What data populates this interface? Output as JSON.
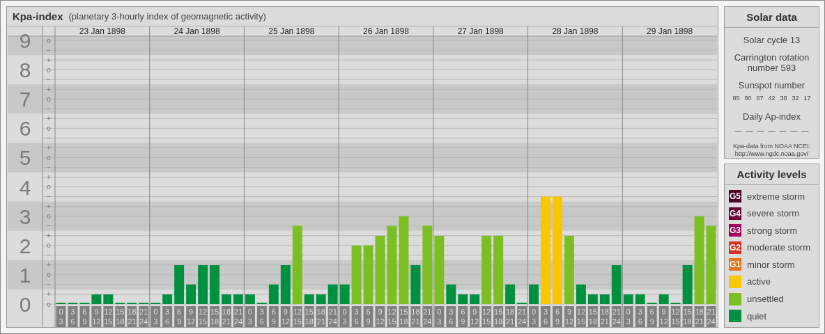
{
  "header": {
    "title": "Kpa-index",
    "subtitle": "(planetary 3-hourly index of geomagnetic activity)"
  },
  "day_headers": [
    "23 Jan 1898",
    "24 Jan 1898",
    "25 Jan 1898",
    "26 Jan 1898",
    "27 Jan 1898",
    "28 Jan 1898",
    "29 Jan 1898"
  ],
  "kp_scale_marks": [
    "o",
    "−",
    "+",
    "o",
    "−",
    "+",
    "o",
    "−",
    "+",
    "o",
    "−",
    "+",
    "o",
    "−",
    "+",
    "o",
    "−",
    "+",
    "o",
    "−",
    "+",
    "o",
    "−",
    "+",
    "o",
    "−",
    "+",
    "o"
  ],
  "chart_data": {
    "type": "bar",
    "grid": true,
    "categories": [
      "0\n3",
      "3\n6",
      "6\n9",
      "9\n12",
      "12\n15",
      "15\n18",
      "18\n21",
      "21\n24",
      "0\n3",
      "3\n6",
      "6\n9",
      "9\n12",
      "12\n15",
      "15\n18",
      "18\n21",
      "21\n24",
      "0\n3",
      "3\n6",
      "6\n9",
      "9\n12",
      "12\n15",
      "15\n18",
      "18\n21",
      "21\n24",
      "0\n3",
      "3\n6",
      "6\n9",
      "9\n12",
      "12\n15",
      "15\n18",
      "18\n21",
      "21\n24",
      "0\n3",
      "3\n6",
      "6\n9",
      "9\n12",
      "12\n15",
      "15\n18",
      "18\n21",
      "21\n24",
      "0\n3",
      "3\n6",
      "6\n9",
      "9\n12",
      "12\n15",
      "15\n18",
      "18\n21",
      "21\n24",
      "0\n3",
      "3\n6",
      "6\n9",
      "9\n12",
      "12\n15",
      "15\n18",
      "18\n21",
      "21\n24"
    ],
    "series": [
      {
        "name": "quiet",
        "color": "#009140",
        "values": [
          0,
          0,
          0,
          0.33,
          0.33,
          0,
          0,
          0,
          0,
          0.33,
          1.33,
          0.67,
          1.33,
          1.33,
          0.33,
          0.33,
          0.33,
          0,
          0.67,
          1.33,
          null,
          0.33,
          0.33,
          0.67,
          0.67,
          null,
          null,
          null,
          null,
          null,
          1.33,
          null,
          null,
          0.67,
          0.33,
          0.33,
          null,
          null,
          0.67,
          0,
          0.67,
          null,
          null,
          null,
          0.67,
          0.33,
          0.33,
          1.33,
          0.33,
          0.33,
          0,
          0.33,
          0,
          1.33,
          null,
          null
        ]
      },
      {
        "name": "unsettled",
        "color": "#7bbf22",
        "values": [
          null,
          null,
          null,
          null,
          null,
          null,
          null,
          null,
          null,
          null,
          null,
          null,
          null,
          null,
          null,
          null,
          null,
          null,
          null,
          null,
          2.67,
          null,
          null,
          null,
          null,
          2,
          2,
          2.33,
          2.67,
          3,
          null,
          2.67,
          2.33,
          null,
          null,
          null,
          2.33,
          2.33,
          null,
          null,
          null,
          null,
          null,
          2.33,
          null,
          null,
          null,
          null,
          null,
          null,
          null,
          null,
          null,
          null,
          3,
          2.67
        ]
      },
      {
        "name": "active",
        "color": "#f9c600",
        "values": [
          null,
          null,
          null,
          null,
          null,
          null,
          null,
          null,
          null,
          null,
          null,
          null,
          null,
          null,
          null,
          null,
          null,
          null,
          null,
          null,
          null,
          null,
          null,
          null,
          null,
          null,
          null,
          null,
          null,
          null,
          null,
          null,
          null,
          null,
          null,
          null,
          null,
          null,
          null,
          null,
          null,
          3.67,
          3.67,
          null,
          null,
          null,
          null,
          null,
          null,
          null,
          null,
          null,
          null,
          null,
          null,
          null
        ]
      }
    ],
    "ylim": [
      0,
      9
    ],
    "yticks": [
      {
        "value": 0,
        "label": "0"
      },
      {
        "value": 1,
        "label": "1"
      },
      {
        "value": 2,
        "label": "2"
      },
      {
        "value": 3,
        "label": "3"
      },
      {
        "value": 4,
        "label": "4"
      },
      {
        "value": 5,
        "label": "5"
      },
      {
        "value": 6,
        "label": "6"
      },
      {
        "value": 7,
        "label": "7"
      },
      {
        "value": 8,
        "label": "8"
      },
      {
        "value": 9,
        "label": "9"
      }
    ]
  },
  "solar_data": {
    "title": "Solar data",
    "cycle": "Solar cycle 13",
    "rotation": "Carrington rotation number 593",
    "sunspot_label": "Sunspot number",
    "sunspot_numbers": [
      "85",
      "80",
      "87",
      "42",
      "38",
      "32",
      "17"
    ],
    "ap_label": "Daily Ap-index",
    "ap_values": [
      "—",
      "—",
      "—",
      "—",
      "—",
      "—",
      "—"
    ],
    "source": "Kpa-data from NOAA NCEI:",
    "source_url": "http://www.ngdc.noaa.gov/"
  },
  "activity_levels": {
    "title": "Activity levels",
    "items": [
      {
        "badge": "G5",
        "label": "extreme storm",
        "color": "#4a0021"
      },
      {
        "badge": "G4",
        "label": "severe storm",
        "color": "#6c0034"
      },
      {
        "badge": "G3",
        "label": "strong storm",
        "color": "#a4005b"
      },
      {
        "badge": "G2",
        "label": "moderate storm",
        "color": "#d7301e"
      },
      {
        "badge": "G1",
        "label": "minor storm",
        "color": "#e5761b"
      }
    ]
  }
}
